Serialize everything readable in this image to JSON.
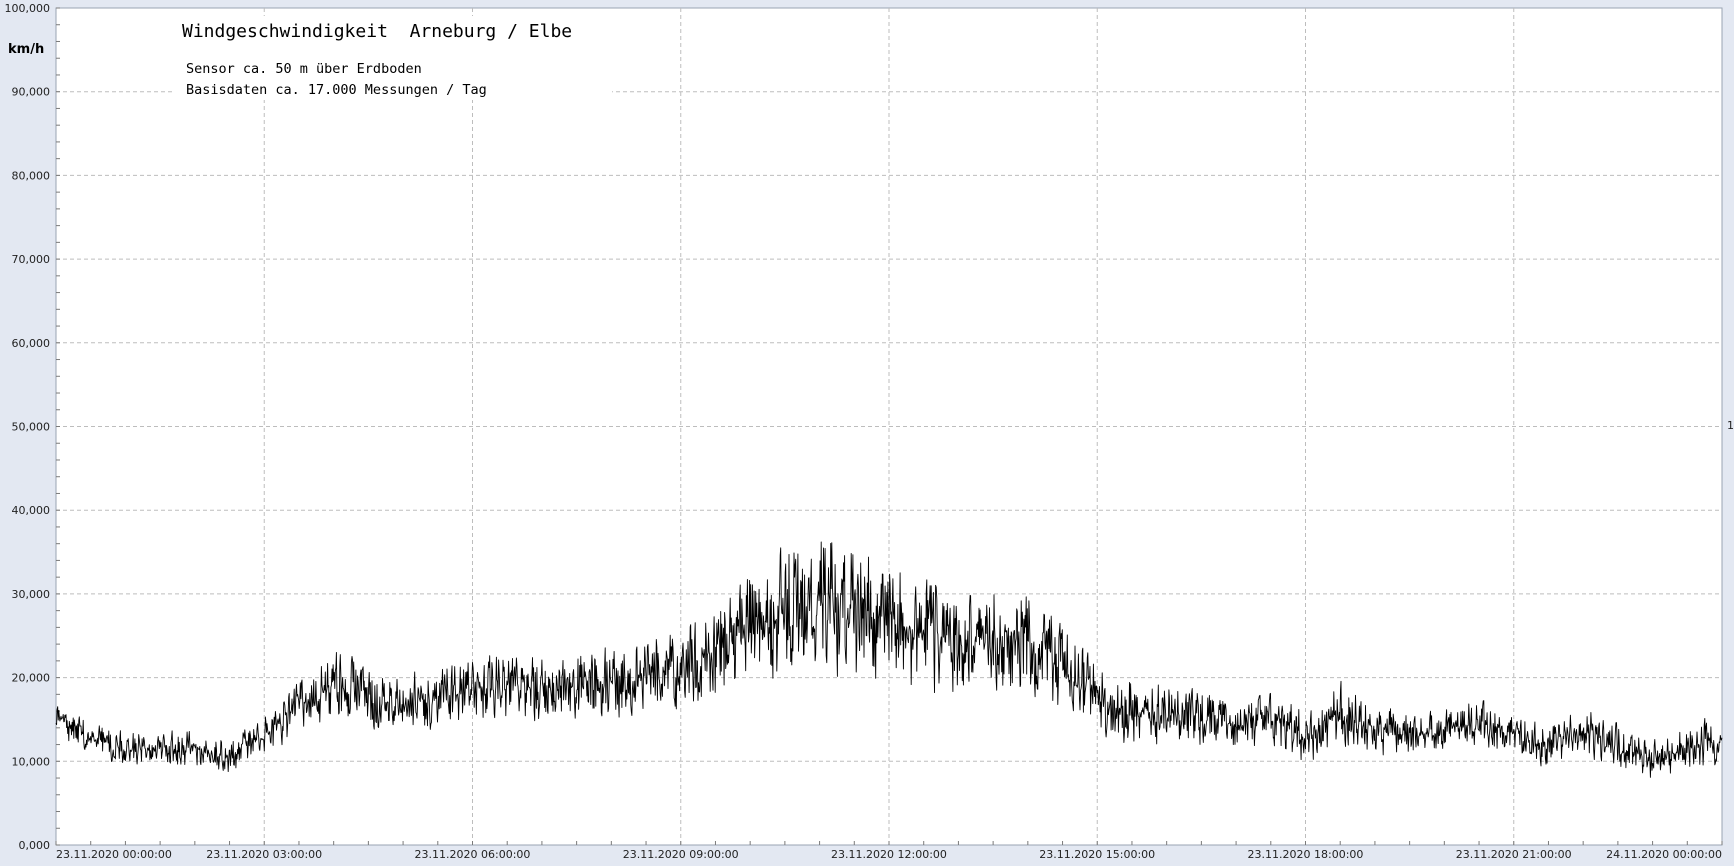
{
  "chart_data": {
    "type": "line",
    "title": "Windgeschwindigkeit  Arneburg / Elbe",
    "subtitle_lines": [
      "Sensor ca. 50 m über Erdboden",
      "Basisdaten ca. 17.000 Messungen / Tag"
    ],
    "ylabel": "km/h",
    "xlabel": "",
    "ylim": [
      0,
      100
    ],
    "xlim_hours": [
      0,
      24
    ],
    "y_ticks": [
      {
        "value": 0,
        "label": "0,000"
      },
      {
        "value": 10,
        "label": "10,000"
      },
      {
        "value": 20,
        "label": "20,000"
      },
      {
        "value": 30,
        "label": "30,000"
      },
      {
        "value": 40,
        "label": "40,000"
      },
      {
        "value": 50,
        "label": "50,000"
      },
      {
        "value": 60,
        "label": "60,000"
      },
      {
        "value": 70,
        "label": "70,000"
      },
      {
        "value": 80,
        "label": "80,000"
      },
      {
        "value": 90,
        "label": "90,000"
      },
      {
        "value": 100,
        "label": "100,000"
      }
    ],
    "x_ticks": [
      {
        "hour": 0,
        "label": "23.11.2020  00:00:00"
      },
      {
        "hour": 3,
        "label": "23.11.2020  03:00:00"
      },
      {
        "hour": 6,
        "label": "23.11.2020  06:00:00"
      },
      {
        "hour": 9,
        "label": "23.11.2020  09:00:00"
      },
      {
        "hour": 12,
        "label": "23.11.2020  12:00:00"
      },
      {
        "hour": 15,
        "label": "23.11.2020  15:00:00"
      },
      {
        "hour": 18,
        "label": "23.11.2020  18:00:00"
      },
      {
        "hour": 21,
        "label": "23.11.2020  21:00:00"
      },
      {
        "hour": 24,
        "label": "24.11.2020  00:00:00"
      }
    ],
    "grid": true,
    "right_marker": "1",
    "series": [
      {
        "color": "#000000",
        "envelope": {
          "hours": [
            0,
            0.5,
            1,
            1.5,
            2,
            2.5,
            3,
            3.5,
            4,
            4.5,
            5,
            5.5,
            6,
            6.5,
            7,
            7.5,
            8,
            8.5,
            9,
            9.5,
            10,
            10.5,
            11,
            11.5,
            12,
            12.5,
            13,
            13.5,
            14,
            14.5,
            15,
            15.5,
            16,
            16.5,
            17,
            17.5,
            18,
            18.5,
            19,
            19.5,
            20,
            20.5,
            21,
            21.5,
            22,
            22.5,
            23,
            23.5,
            24
          ],
          "min": [
            13,
            10,
            9,
            9,
            9,
            8,
            10,
            13,
            14,
            13,
            13,
            13,
            14,
            14,
            14,
            14,
            14,
            14,
            15,
            16,
            18,
            18,
            19,
            18,
            17,
            17,
            16,
            17,
            17,
            15,
            12,
            11,
            11,
            11,
            11,
            11,
            9,
            11,
            10,
            10,
            11,
            11,
            10,
            9,
            10,
            9,
            7,
            8,
            9
          ],
          "max": [
            18,
            15,
            14,
            14,
            14,
            13,
            16,
            20,
            24,
            22,
            21,
            22,
            23,
            24,
            23,
            24,
            25,
            26,
            27,
            30,
            34,
            37,
            40,
            38,
            36,
            34,
            31,
            33,
            34,
            27,
            23,
            21,
            20,
            19,
            18,
            19,
            17,
            20,
            18,
            16,
            17,
            18,
            16,
            15,
            17,
            15,
            13,
            15,
            16
          ]
        }
      }
    ]
  }
}
